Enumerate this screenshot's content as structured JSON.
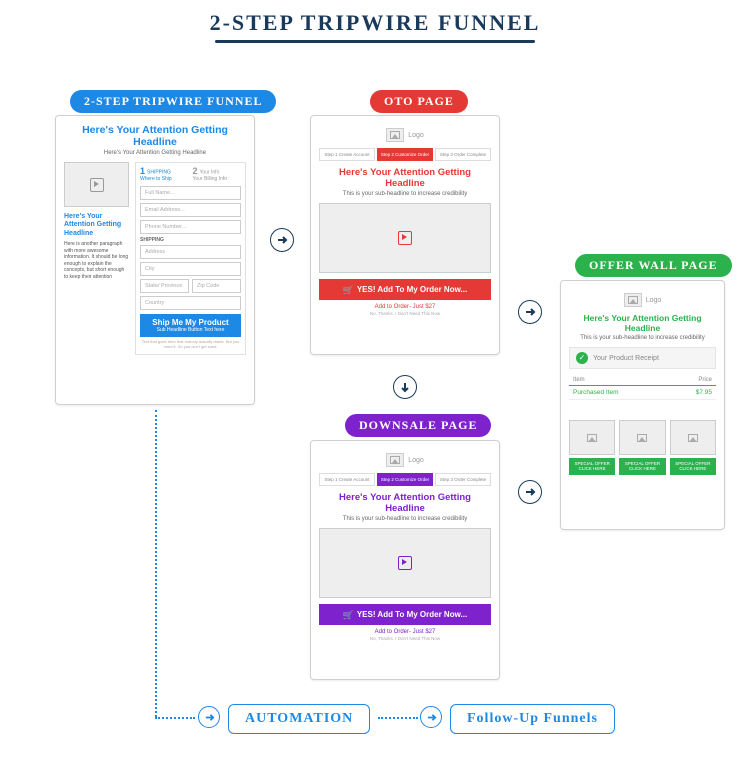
{
  "title": "2-STEP TRIPWIRE FUNNEL",
  "labels": {
    "card1": "2-STEP TRIPWIRE FUNNEL",
    "card2": "OTO PAGE",
    "card3": "DOWNSALE PAGE",
    "card4": "OFFER WALL PAGE"
  },
  "card1": {
    "headline": "Here's Your Attention Getting Headline",
    "sub": "Here's Your Attention Getting Headline",
    "left_headline": "Here's Your Attention Getting Headline",
    "left_para": "Here is another paragraph with more awesome information. It should be long enough to explain the concepts, but short enough to keep their attention",
    "step1_num": "1",
    "step1_title": "SHIPPING",
    "step1_sub": "Where to Ship",
    "step2_num": "2",
    "step2_title": "Your Info",
    "step2_sub": "Your Billing Info",
    "fields": {
      "full_name": "Full Name...",
      "email": "Email Address...",
      "phone": "Phone Number...",
      "ship_label": "SHIPPING",
      "address": "Address",
      "city": "City",
      "state": "State/ Province",
      "zip": "Zip Code",
      "country": "Country"
    },
    "button_line1": "Ship Me My Product",
    "button_line2": "Sub Headline Button Text here",
    "fineprint": "Text that goes here that nobody actually reads. But you need it. So you don't get sued."
  },
  "steps": {
    "s1": "Step 1 Create Account",
    "s2": "Step 2 Customize Order",
    "s3": "Step 3 Order Complete"
  },
  "oto": {
    "logo": "Logo",
    "headline": "Here's Your Attention Getting Headline",
    "sub": "This is your sub-headline to increase credibility",
    "cta": "YES! Add To My Order Now...",
    "addline": "Add to Order- Just $27",
    "nothanks": "No, Thanks. I Don't Need This Now"
  },
  "downsale": {
    "logo": "Logo",
    "headline": "Here's Your Attention Getting Headline",
    "sub": "This is your sub-headline to increase credibility",
    "cta": "YES! Add To My Order Now...",
    "addline": "Add to Order- Just $27",
    "nothanks": "No, Thanks. I Don't Need This Now"
  },
  "offerwall": {
    "logo": "Logo",
    "headline": "Here's Your Attention Getting Headline",
    "sub": "This is your sub-headline to increase credibility",
    "receipt": "Your Product Receipt",
    "col_item": "Item",
    "col_price": "Price",
    "row_item": "Purchased Item",
    "row_price": "$7.95",
    "offer_btn": "SPECIAL OFFER CLICK HERE"
  },
  "bottom": {
    "automation": "AUTOMATION",
    "followup": "Follow-Up Funnels"
  }
}
